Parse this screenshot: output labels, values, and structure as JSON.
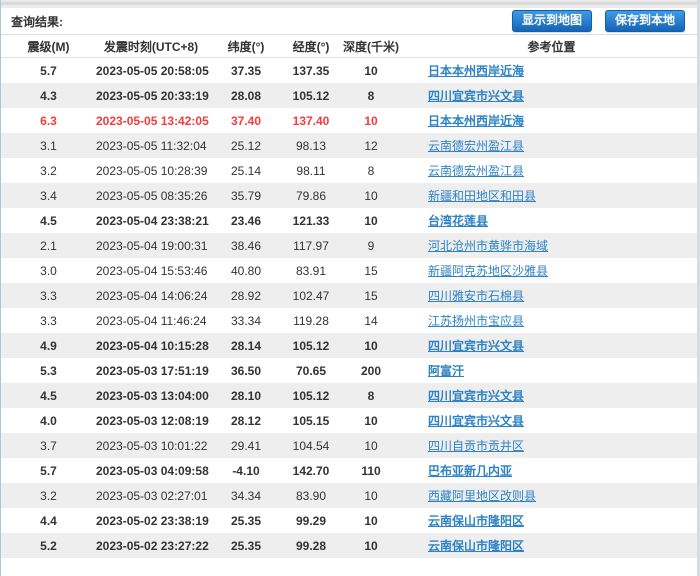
{
  "header": {
    "results_label": "查询结果:",
    "buttons": [
      {
        "label": "显示到地图"
      },
      {
        "label": "保存到本地"
      }
    ]
  },
  "table": {
    "columns": [
      "震级(M)",
      "发震时刻(UTC+8)",
      "纬度(°)",
      "经度(°)",
      "深度(千米)",
      "参考位置"
    ],
    "rows": [
      {
        "magnitude": "5.7",
        "time": "2023-05-05 20:58:05",
        "latitude": "37.35",
        "longitude": "137.35",
        "depth": "10",
        "location": "日本本州西岸近海",
        "bold": true,
        "red": false
      },
      {
        "magnitude": "4.3",
        "time": "2023-05-05 20:33:19",
        "latitude": "28.08",
        "longitude": "105.12",
        "depth": "8",
        "location": "四川宜宾市兴文县",
        "bold": true,
        "red": false
      },
      {
        "magnitude": "6.3",
        "time": "2023-05-05 13:42:05",
        "latitude": "37.40",
        "longitude": "137.40",
        "depth": "10",
        "location": "日本本州西岸近海",
        "bold": true,
        "red": true
      },
      {
        "magnitude": "3.1",
        "time": "2023-05-05 11:32:04",
        "latitude": "25.12",
        "longitude": "98.13",
        "depth": "12",
        "location": "云南德宏州盈江县",
        "bold": false,
        "red": false
      },
      {
        "magnitude": "3.2",
        "time": "2023-05-05 10:28:39",
        "latitude": "25.14",
        "longitude": "98.11",
        "depth": "8",
        "location": "云南德宏州盈江县",
        "bold": false,
        "red": false
      },
      {
        "magnitude": "3.4",
        "time": "2023-05-05 08:35:26",
        "latitude": "35.79",
        "longitude": "79.86",
        "depth": "10",
        "location": "新疆和田地区和田县",
        "bold": false,
        "red": false
      },
      {
        "magnitude": "4.5",
        "time": "2023-05-04 23:38:21",
        "latitude": "23.46",
        "longitude": "121.33",
        "depth": "10",
        "location": "台湾花莲县",
        "bold": true,
        "red": false
      },
      {
        "magnitude": "2.1",
        "time": "2023-05-04 19:00:31",
        "latitude": "38.46",
        "longitude": "117.97",
        "depth": "9",
        "location": "河北沧州市黄骅市海域",
        "bold": false,
        "red": false
      },
      {
        "magnitude": "3.0",
        "time": "2023-05-04 15:53:46",
        "latitude": "40.80",
        "longitude": "83.91",
        "depth": "15",
        "location": "新疆阿克苏地区沙雅县",
        "bold": false,
        "red": false
      },
      {
        "magnitude": "3.3",
        "time": "2023-05-04 14:06:24",
        "latitude": "28.92",
        "longitude": "102.47",
        "depth": "15",
        "location": "四川雅安市石棉县",
        "bold": false,
        "red": false
      },
      {
        "magnitude": "3.3",
        "time": "2023-05-04 11:46:24",
        "latitude": "33.34",
        "longitude": "119.28",
        "depth": "14",
        "location": "江苏扬州市宝应县",
        "bold": false,
        "red": false
      },
      {
        "magnitude": "4.9",
        "time": "2023-05-04 10:15:28",
        "latitude": "28.14",
        "longitude": "105.12",
        "depth": "10",
        "location": "四川宜宾市兴文县",
        "bold": true,
        "red": false
      },
      {
        "magnitude": "5.3",
        "time": "2023-05-03 17:51:19",
        "latitude": "36.50",
        "longitude": "70.65",
        "depth": "200",
        "location": "阿富汗",
        "bold": true,
        "red": false
      },
      {
        "magnitude": "4.5",
        "time": "2023-05-03 13:04:00",
        "latitude": "28.10",
        "longitude": "105.12",
        "depth": "8",
        "location": "四川宜宾市兴文县",
        "bold": true,
        "red": false
      },
      {
        "magnitude": "4.0",
        "time": "2023-05-03 12:08:19",
        "latitude": "28.12",
        "longitude": "105.15",
        "depth": "10",
        "location": "四川宜宾市兴文县",
        "bold": true,
        "red": false
      },
      {
        "magnitude": "3.7",
        "time": "2023-05-03 10:01:22",
        "latitude": "29.41",
        "longitude": "104.54",
        "depth": "10",
        "location": "四川自贡市贡井区",
        "bold": false,
        "red": false
      },
      {
        "magnitude": "5.7",
        "time": "2023-05-03 04:09:58",
        "latitude": "-4.10",
        "longitude": "142.70",
        "depth": "110",
        "location": "巴布亚新几内亚",
        "bold": true,
        "red": false
      },
      {
        "magnitude": "3.2",
        "time": "2023-05-03 02:27:01",
        "latitude": "34.34",
        "longitude": "83.90",
        "depth": "10",
        "location": "西藏阿里地区改则县",
        "bold": false,
        "red": false
      },
      {
        "magnitude": "4.4",
        "time": "2023-05-02 23:38:19",
        "latitude": "25.35",
        "longitude": "99.29",
        "depth": "10",
        "location": "云南保山市隆阳区",
        "bold": true,
        "red": false
      },
      {
        "magnitude": "5.2",
        "time": "2023-05-02 23:27:22",
        "latitude": "25.35",
        "longitude": "99.28",
        "depth": "10",
        "location": "云南保山市隆阳区",
        "bold": true,
        "red": false
      }
    ]
  },
  "colors": {
    "button_blue_top": "#3f9ae3",
    "button_blue_bottom": "#1565b5",
    "link_blue": "#2e83c4",
    "alert_red": "#f53b3b",
    "row_alt_gray": "#eeeeee"
  }
}
